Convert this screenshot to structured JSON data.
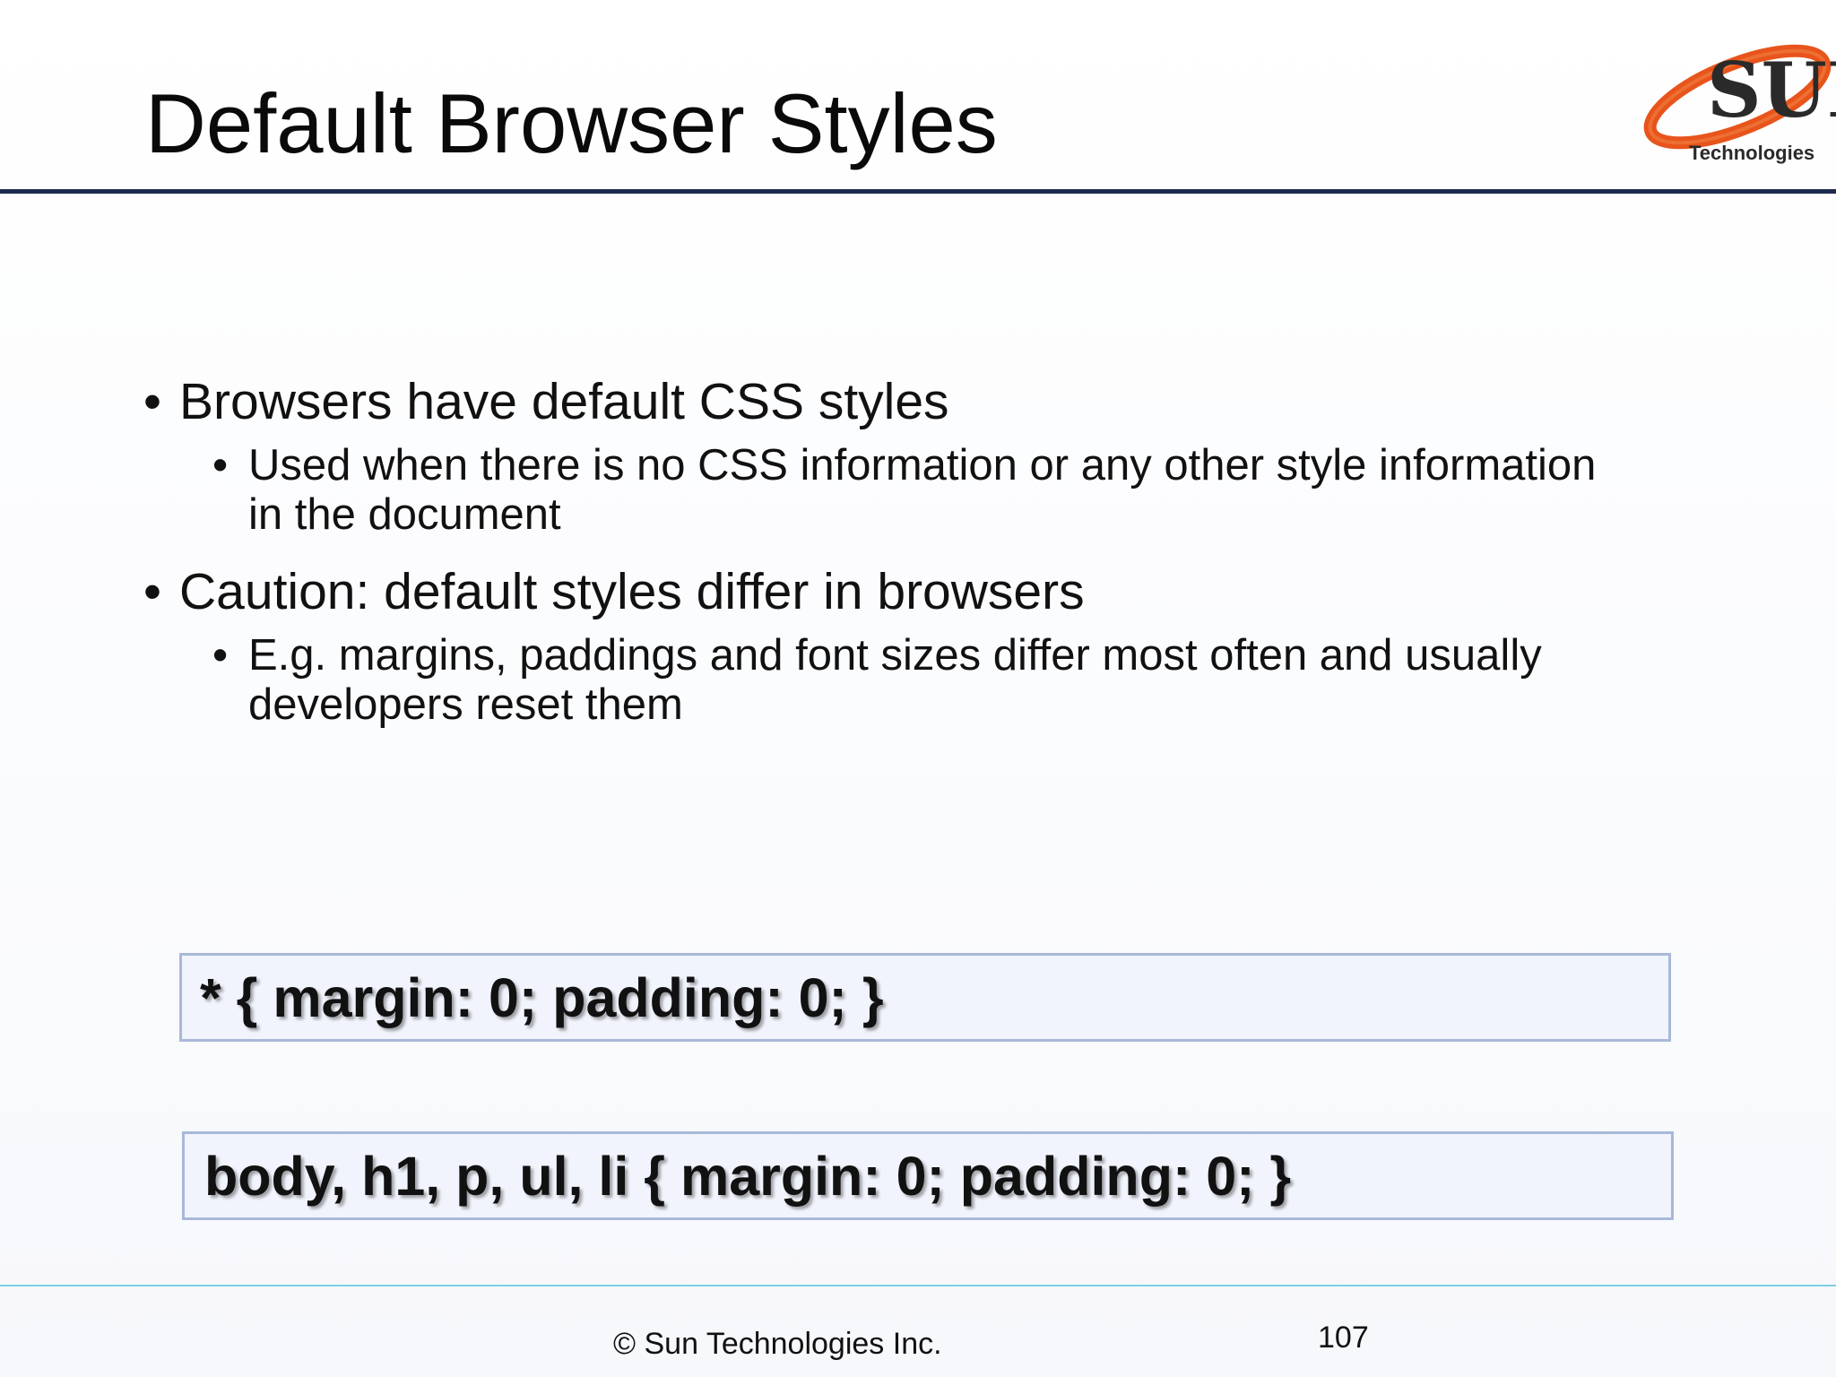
{
  "slide": {
    "title": "Default Browser Styles",
    "logo_text": "Technologies",
    "logo_letters": "SUN",
    "bullets": [
      {
        "text": "Browsers have default CSS styles",
        "sub": "Used when there is no CSS information or any other style information in the document"
      },
      {
        "text": "Caution: default styles differ in browsers",
        "sub": "E.g. margins, paddings and font sizes differ most often and usually developers reset them"
      }
    ],
    "bullet_symbol": "•",
    "code_examples": [
      "* { margin: 0; padding: 0; }",
      "body, h1, p, ul, li { margin: 0; padding: 0; }"
    ],
    "footer": {
      "copyright": "© Sun Technologies Inc.",
      "page_number": "107"
    }
  },
  "colors": {
    "title_rule": "#1d2b4d",
    "code_box_bg": "#f1f4fc",
    "code_box_border": "#a9b8d9",
    "footer_rule": "#7fd0e6",
    "logo_orange": "#e8541b"
  }
}
